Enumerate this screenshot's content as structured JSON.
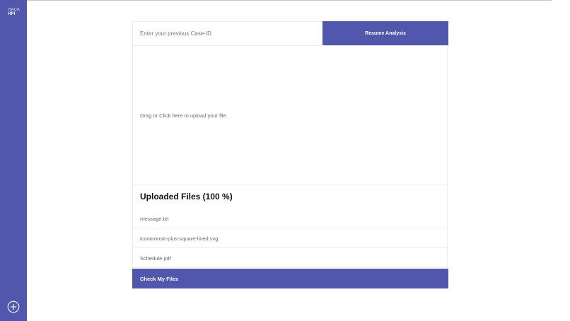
{
  "sidebar": {
    "logo_line1": "HACK",
    "logo_line2": "HPI",
    "add_icon": "plus-circle-icon",
    "color": "#5057ad"
  },
  "case": {
    "placeholder": "Enter your previous Case-ID",
    "value": "",
    "resume_label": "Resume Analysis"
  },
  "upload": {
    "dropzone_text": "Drag or Click here to upload your file.",
    "title": "Uploaded Files (100 %)",
    "progress_percent": 100,
    "files": [
      {
        "name": "message.txt"
      },
      {
        "name": "iconmonstr-plus-square-lined.svg"
      },
      {
        "name": "Schedule.pdf"
      }
    ],
    "check_label": "Check My Files"
  },
  "colors": {
    "accent": "#5057ad",
    "border": "#ececec",
    "muted_text": "#6b6b6b"
  }
}
